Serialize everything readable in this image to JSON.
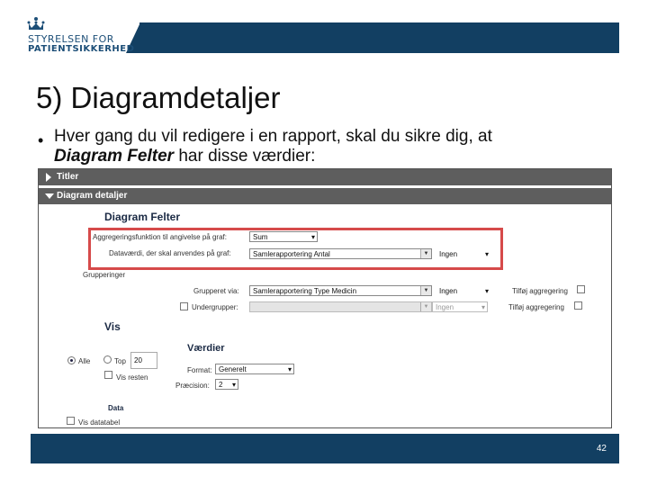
{
  "logo": {
    "line1": "STYRELSEN FOR",
    "line2": "PATIENTSIKKERHED"
  },
  "slide": {
    "title": "5) Diagramdetaljer",
    "bullet_line1": "Hver gang du vil redigere i en rapport, skal du sikre dig, at",
    "bullet_line2_emphasis": "Diagram Felter",
    "bullet_line2_rest": " har disse værdier:",
    "page_number": "42"
  },
  "colors": {
    "brand": "#123f62",
    "highlight": "#d64a4a",
    "section_bar": "#5e5e5e"
  },
  "screenshot": {
    "sections": {
      "titler": "Titler",
      "diagram_detaljer": "Diagram detaljer"
    },
    "diagram_felter": {
      "heading": "Diagram Felter",
      "aggregation_label": "Aggregeringsfunktion til angivelse på graf:",
      "aggregation_value": "Sum",
      "datavaerdi_label": "Dataværdi, der skal anvendes på graf:",
      "datavaerdi_value": "Samlerapportering Antal",
      "datavaerdi_second": "Ingen",
      "grupperinger_label": "Grupperinger",
      "grupperet_label": "Grupperet via:",
      "grupperet_value": "Samlerapportering Type Medicin",
      "grupperet_second": "Ingen",
      "tilfoej_aggregering_1": "Tilføj aggregering",
      "undergrupper_label": "Undergrupper:",
      "undergrupper_second": "Ingen",
      "tilfoej_aggregering_2": "Tilføj aggregering"
    },
    "vis": {
      "heading": "Vis",
      "alle_label": "Alle",
      "top_label": "Top",
      "top_value": "20",
      "vis_resten_label": "Vis resten"
    },
    "vaerdier": {
      "heading": "Værdier",
      "format_label": "Format:",
      "format_value": "Generelt",
      "praecision_label": "Præcision:",
      "praecision_value": "2"
    },
    "data": {
      "heading": "Data",
      "vis_datatabel_label": "Vis datatabel"
    }
  }
}
